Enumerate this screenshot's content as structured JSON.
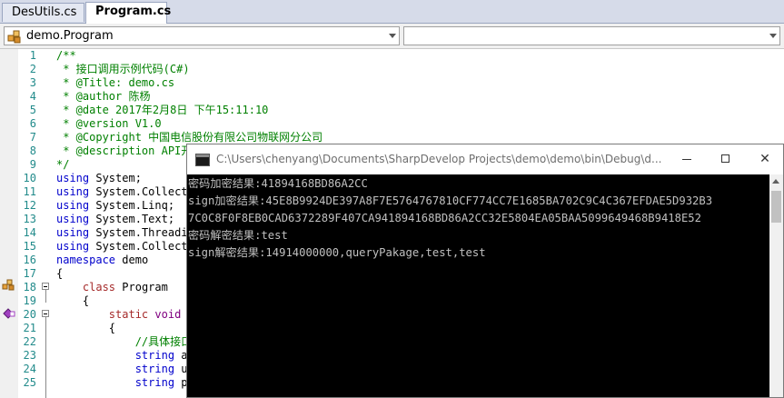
{
  "tabs": [
    {
      "label": "DesUtils.cs"
    },
    {
      "label": "Program.cs"
    }
  ],
  "navbar": {
    "class_combo": "demo.Program",
    "member_combo": ""
  },
  "editor": {
    "line_numbers": [
      "1",
      "2",
      "3",
      "4",
      "5",
      "6",
      "7",
      "8",
      "9",
      "10",
      "11",
      "12",
      "13",
      "14",
      "15",
      "16",
      "17",
      "18",
      "19",
      "20",
      "21",
      "22",
      "23",
      "24",
      "25"
    ],
    "lines": [
      "/**",
      " * 接口调用示例代码(C#)",
      " * @Title: demo.cs",
      " * @author 陈杨",
      " * @date 2017年2月8日 下午15:11:10",
      " * @version V1.0",
      " * @Copyright 中国电信股份有限公司物联网分公司",
      " * @description API开",
      "*/",
      "using System;",
      "using System.Collecti",
      "using System.Linq;",
      "using System.Text;",
      "using System.Threadi",
      "using System.Collecti",
      "namespace demo",
      "{",
      "    class Program",
      "    {",
      "        static void M",
      "        {",
      "            //具体接口",
      "            string ad",
      "            string us",
      "            string pa"
    ]
  },
  "console": {
    "title": "C:\\Users\\chenyang\\Documents\\SharpDevelop Projects\\demo\\demo\\bin\\Debug\\d...",
    "output": [
      "密码加密结果:41894168BD86A2CC",
      "sign加密结果:45E8B9924DE397A8F7E5764767810CF774CC7E1685BA702C9C4C367EFDAE5D932B3",
      "7C0C8F0F8EB0CAD6372289F407CA941894168BD86A2CC32E5804EA05BAA5099649468B9418E52",
      "密码解密结果:test",
      "sign解密结果:14914000000,queryPakage,test,test"
    ]
  }
}
